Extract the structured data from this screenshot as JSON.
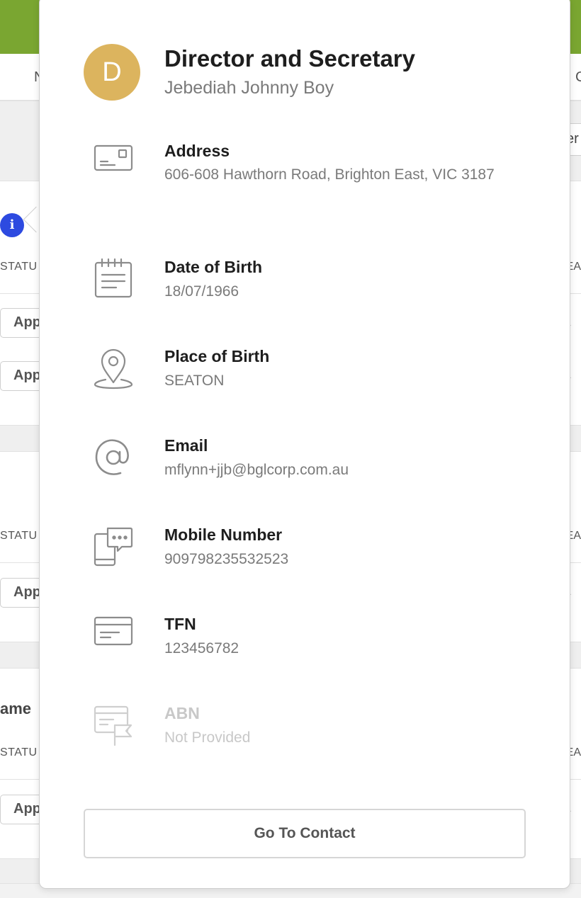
{
  "background": {
    "nav_left": "N",
    "nav_right": "C",
    "right_button": "er",
    "status_label": "STATU",
    "status_right": "EA",
    "app_button_label": "App",
    "row_dash": "-",
    "side_text": "ame",
    "info_glyph": "i"
  },
  "popover": {
    "avatar_initial": "D",
    "title": "Director and Secretary",
    "subtitle": "Jebediah Johnny Boy",
    "fields": [
      {
        "label": "Address",
        "value": "606-608 Hawthorn Road, Brighton East, VIC 3187",
        "icon": "address-card-icon"
      },
      {
        "label": "Date of Birth",
        "value": "18/07/1966",
        "icon": "calendar-icon"
      },
      {
        "label": "Place of Birth",
        "value": "SEATON",
        "icon": "location-pin-icon"
      },
      {
        "label": "Email",
        "value": "mflynn+jjb@bglcorp.com.au",
        "icon": "at-sign-icon"
      },
      {
        "label": "Mobile Number",
        "value": "909798235532523",
        "icon": "mobile-chat-icon"
      },
      {
        "label": "TFN",
        "value": "123456782",
        "icon": "card-icon"
      },
      {
        "label": "ABN",
        "value": "Not Provided",
        "icon": "card-flag-icon"
      }
    ],
    "button_label": "Go To Contact"
  },
  "colors": {
    "topbar": "#7aa631",
    "avatar": "#dcb45e",
    "info_dot": "#2d4ae0",
    "icon_stroke": "#8c8c8c",
    "disabled": "#c8c8c8"
  }
}
